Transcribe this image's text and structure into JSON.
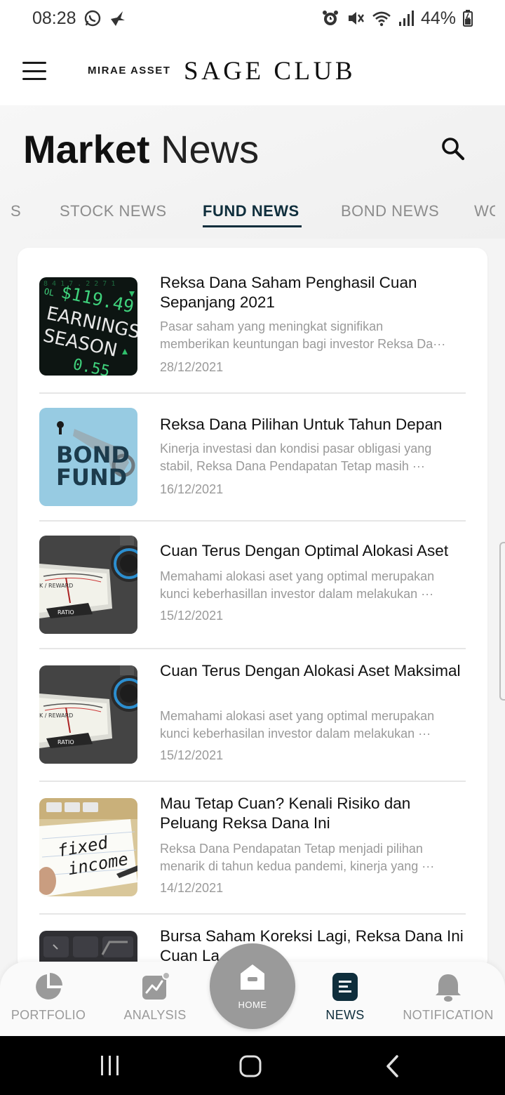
{
  "status_bar": {
    "time": "08:28",
    "battery": "44%",
    "icons": [
      "whatsapp-icon",
      "bird-icon",
      "alarm-icon",
      "mute-icon",
      "wifi-icon",
      "signal-icon",
      "battery-icon"
    ]
  },
  "header": {
    "brand_small": "MIRAE ASSET",
    "brand_big": "SAGE CLUB"
  },
  "page": {
    "title_bold": "Market",
    "title_light": "News"
  },
  "tabs": [
    {
      "label": "S",
      "active": false
    },
    {
      "label": "STOCK NEWS",
      "active": false
    },
    {
      "label": "FUND NEWS",
      "active": true
    },
    {
      "label": "BOND NEWS",
      "active": false
    },
    {
      "label": "WO",
      "active": false
    }
  ],
  "news": [
    {
      "title": "Reksa Dana Saham Penghasil Cuan Sepanjang 2021",
      "desc_line1": "Pasar saham yang meningkat signifikan",
      "desc_line2": "memberikan keuntungan bagi investor Reksa Da···",
      "date": "28/12/2021",
      "image": "earnings-season"
    },
    {
      "title": "Reksa Dana Pilihan Untuk Tahun Depan",
      "desc_line1": "Kinerja investasi dan kondisi pasar obligasi yang",
      "desc_line2": "stabil, Reksa Dana Pendapatan Tetap masih ···",
      "date": "16/12/2021",
      "image": "bond-fund"
    },
    {
      "title": "Cuan Terus Dengan Optimal Alokasi Aset",
      "desc_line1": "Memahami alokasi aset  yang optimal merupakan",
      "desc_line2": "kunci keberhasillan investor dalam melakukan ···",
      "date": "15/12/2021",
      "image": "ratio-gauge"
    },
    {
      "title": "Cuan Terus Dengan Alokasi Aset Maksimal",
      "desc_line1": "Memahami alokasi aset yang optimal merupakan",
      "desc_line2": "kunci keberhasilan investor dalam melakukan ···",
      "date": "15/12/2021",
      "image": "ratio-gauge"
    },
    {
      "title": "Mau Tetap Cuan? Kenali Risiko dan Peluang Reksa Dana Ini",
      "desc_line1": "Reksa Dana Pendapatan Tetap menjadi pilihan",
      "desc_line2": "menarik di tahun kedua pandemi, kinerja yang ···",
      "date": "14/12/2021",
      "image": "fixed-income"
    },
    {
      "title": "Bursa Saham Koreksi Lagi, Reksa Dana Ini Cuan La",
      "image": "keyboard"
    }
  ],
  "thumb_text": {
    "earnings_price": "$119.49",
    "earnings_line1": "EARNINGS",
    "earnings_line2": "SEASON",
    "earnings_small": "0.55",
    "earnings_sym": "OL",
    "bond_word1": "BOND",
    "bond_word2": "FUND",
    "ratio_label": "RATIO",
    "ratio_scale": "K / REWARD",
    "fixed_word1": "fixed",
    "fixed_word2": "income"
  },
  "bottom_nav": {
    "portfolio": "PORTFOLIO",
    "analysis": "ANALYSIS",
    "home": "HOME",
    "news": "NEWS",
    "notification": "NOTIFICATION"
  },
  "colors": {
    "accent": "#0f2e3c",
    "muted": "#9a9a9a",
    "home_button": "#9a9a9a"
  }
}
